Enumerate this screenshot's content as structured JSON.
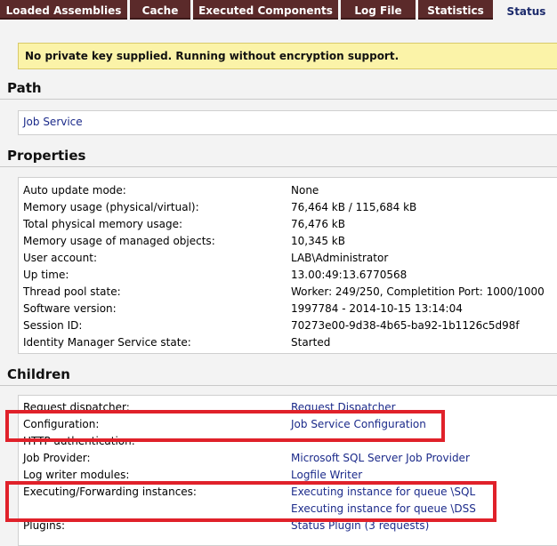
{
  "tabs": [
    {
      "label": "Loaded Assemblies"
    },
    {
      "label": "Cache"
    },
    {
      "label": "Executed Components"
    },
    {
      "label": "Log File"
    },
    {
      "label": "Statistics"
    },
    {
      "label": "Status"
    }
  ],
  "alert": "No private key supplied. Running without encryption support.",
  "path": {
    "heading": "Path",
    "link": "Job Service"
  },
  "properties": {
    "heading": "Properties",
    "rows": [
      {
        "key": "Auto update mode:",
        "value": "None"
      },
      {
        "key": "Memory usage (physical/virtual):",
        "value": "76,464 kB / 115,684 kB"
      },
      {
        "key": "Total physical memory usage:",
        "value": "76,476 kB"
      },
      {
        "key": "Memory usage of managed objects:",
        "value": "10,345 kB"
      },
      {
        "key": "User account:",
        "value": "LAB\\Administrator"
      },
      {
        "key": "Up time:",
        "value": "13.00:49:13.6770568"
      },
      {
        "key": "Thread pool state:",
        "value": "Worker: 249/250, Completition Port: 1000/1000"
      },
      {
        "key": "Software version:",
        "value": "1997784 - 2014-10-15 13:14:04"
      },
      {
        "key": "Session ID:",
        "value": "70273e00-9d38-4b65-ba92-1b1126c5d98f"
      },
      {
        "key": "Identity Manager Service state:",
        "value": "Started"
      }
    ]
  },
  "children": {
    "heading": "Children",
    "rows": [
      {
        "key": "Request dispatcher:",
        "value": "Request Dispatcher"
      },
      {
        "key": "Configuration:",
        "value": "Job Service Configuration"
      },
      {
        "key": "HTTP authentication:",
        "value": ""
      },
      {
        "key": "Job Provider:",
        "value": "Microsoft SQL Server Job Provider"
      },
      {
        "key": "Log writer modules:",
        "value": "Logfile Writer"
      },
      {
        "key": "Executing/Forwarding instances:",
        "value": "Executing instance for queue \\SQL"
      },
      {
        "key": "",
        "value": "Executing instance for queue \\DSS"
      },
      {
        "key": "Plugins:",
        "value": "Status Plugin (3 requests)"
      }
    ]
  },
  "colors": {
    "tab_bg": "#5b2a2a",
    "highlight": "#e0212a",
    "link": "#1b2a8a",
    "alert_bg": "#fbf3a8"
  }
}
